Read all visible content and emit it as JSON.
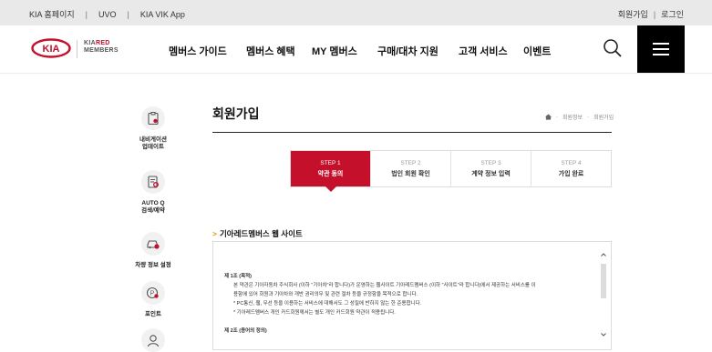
{
  "topbar": {
    "left_links": [
      "KIA 홈페이지",
      "UVO",
      "KIA VIK App"
    ],
    "separator": "|",
    "right_links": [
      "회원가입",
      "로그인"
    ]
  },
  "header": {
    "logo_text": "KIA",
    "members_line1": "KIA",
    "members_highlight": "RED",
    "members_line2": "MEMBERS",
    "nav": [
      "멤버스 가이드",
      "멤버스 혜택",
      "MY 멤버스",
      "구매/대차 지원",
      "고객 서비스",
      "이벤트"
    ]
  },
  "sidebar": {
    "items": [
      {
        "label": "내비게이션\n업데이트",
        "icon": "clipboard-icon"
      },
      {
        "label": "AUTO Q\n검색/예약",
        "icon": "document-search-icon"
      },
      {
        "label": "차량 정보 설정",
        "icon": "car-settings-icon"
      },
      {
        "label": "포인트",
        "icon": "point-coin-icon"
      },
      {
        "label": "",
        "icon": "user-icon"
      }
    ]
  },
  "page": {
    "title": "회원가입",
    "breadcrumb": [
      "회원정보",
      "회원가입"
    ]
  },
  "steps": [
    {
      "num": "STEP 1",
      "label": "약관 동의",
      "active": true
    },
    {
      "num": "STEP 2",
      "label": "법인 회원 확인",
      "active": false
    },
    {
      "num": "STEP 3",
      "label": "계약 정보 입력",
      "active": false
    },
    {
      "num": "STEP 4",
      "label": "가입 완료",
      "active": false
    }
  ],
  "terms": {
    "section_title": "기아레드멤버스 웹 사이트",
    "article1_title": "제 1조 (목적)",
    "article1_lines": [
      "본 약관은 기아자동차 주식회사 (이하 \"기아차\"라 합니다)가 운영하는 웹사이트 기아레드멤버스 (이하 \"사이트\"라 합니다)에서 제공하는 서비스를 이",
      "용함에 있어 회원과 기아차와 개반 권리의무 및 관련 절차 등을 규정함을 목적으로 합니다.",
      "* PC통신, 웹, 무선 등을 이용하는 서비스에 대해서도 그 성질에 반하지 않는 한 준용합니다.",
      "* 기아레드멤버스 개인 카드회원께서는 별도 개인 카드회원 약관이 적용됩니다."
    ],
    "article2_title": "제 2조 (용어의 정의)"
  }
}
